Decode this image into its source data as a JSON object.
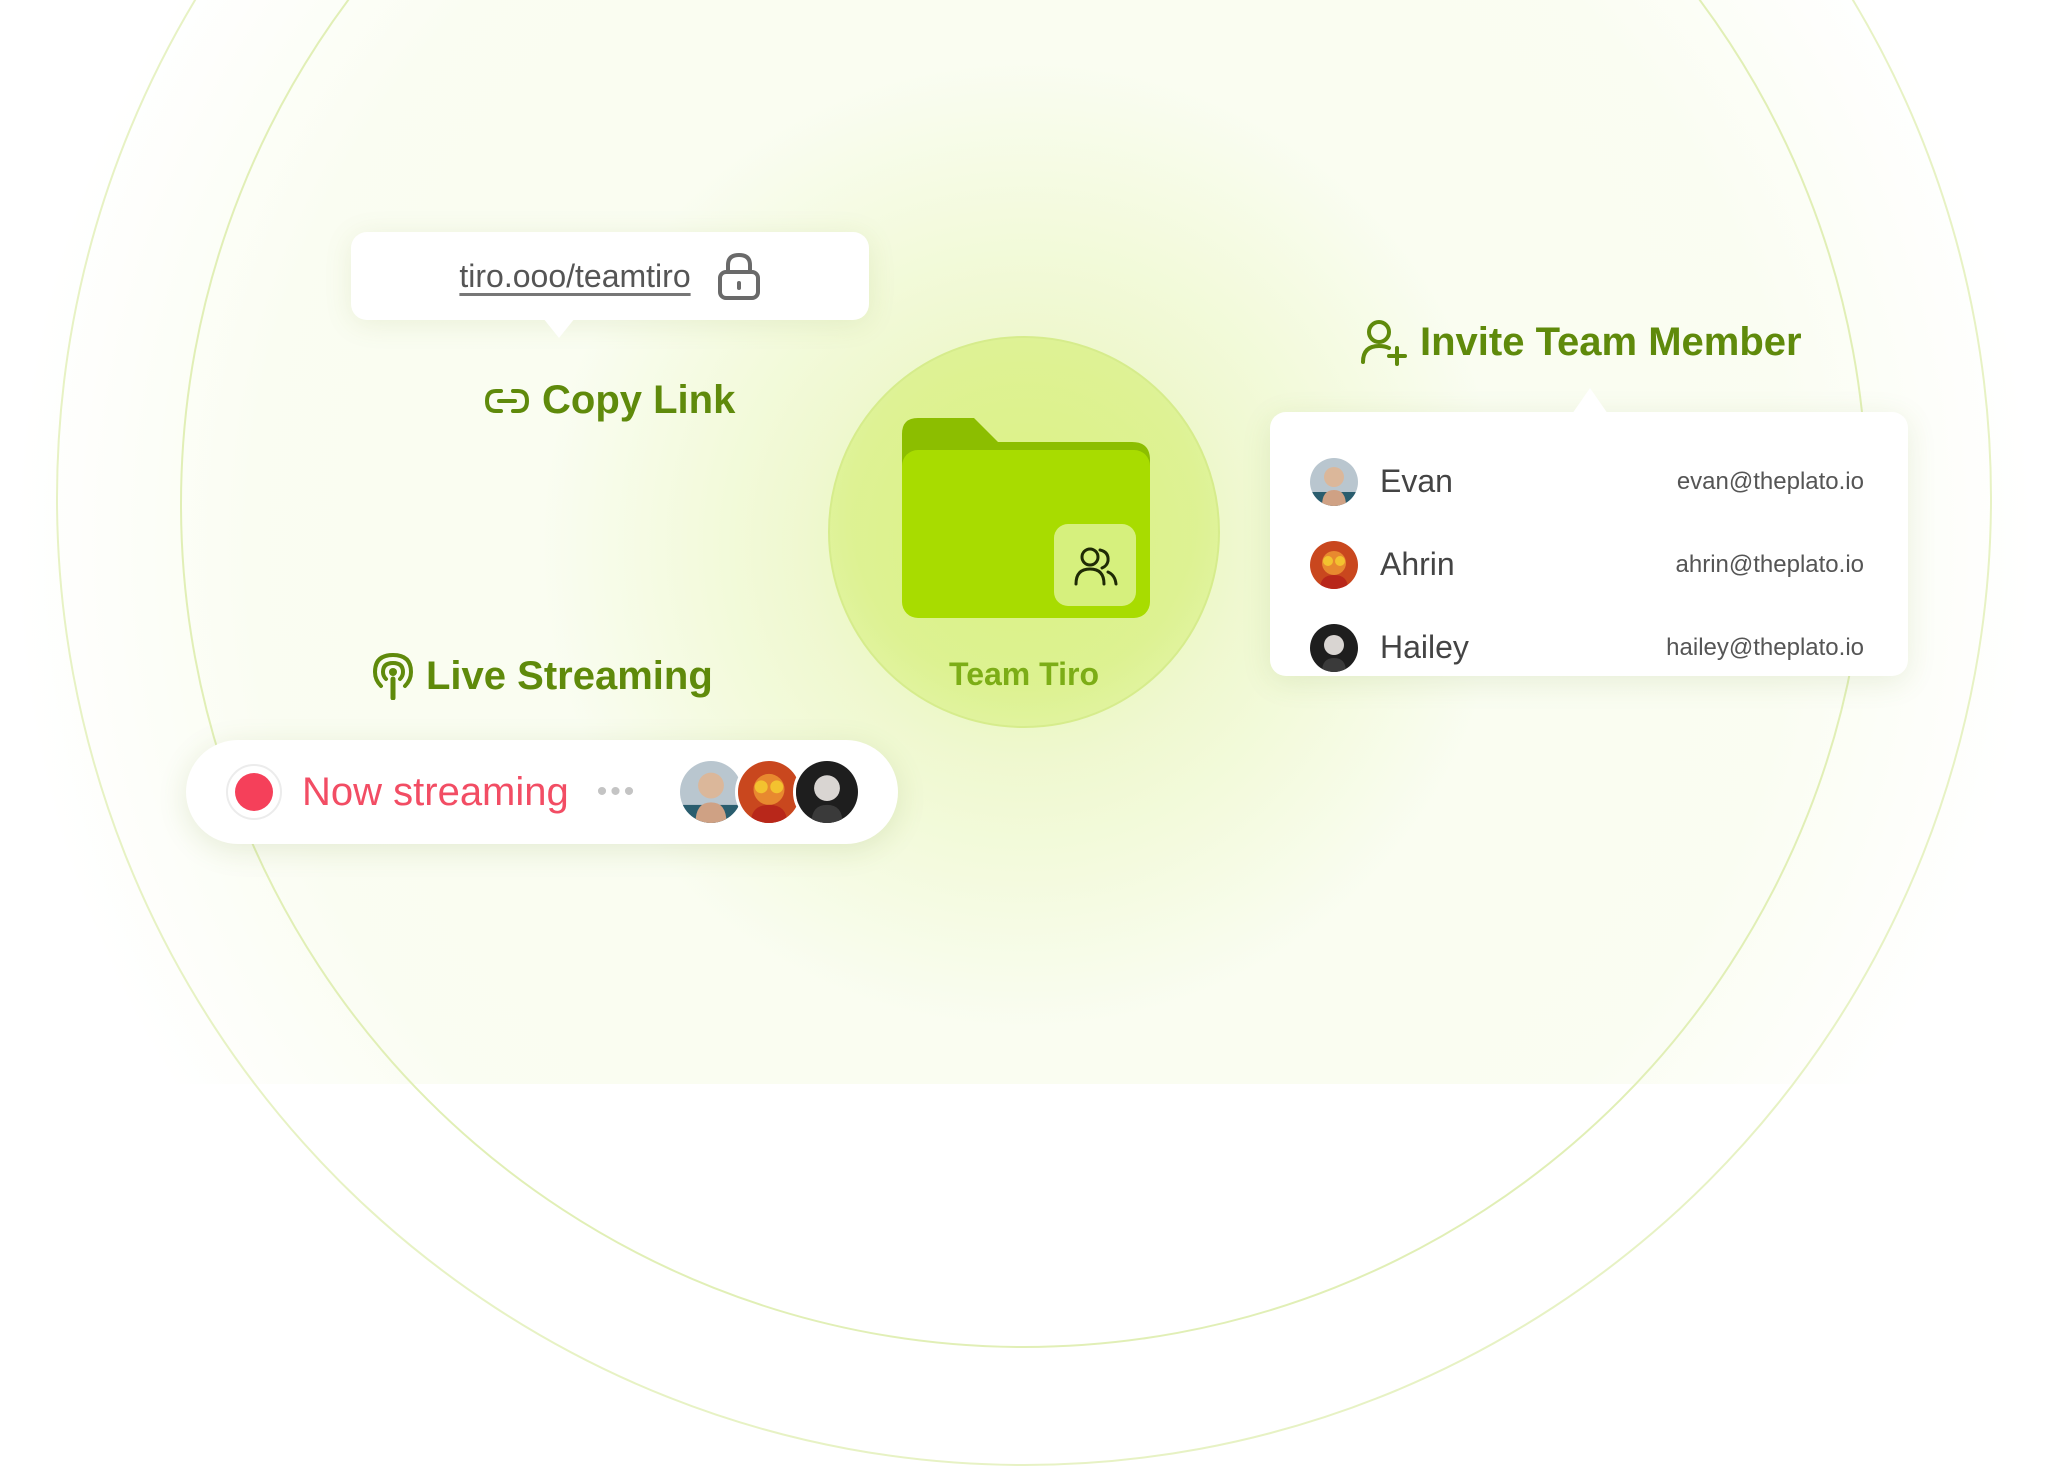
{
  "team": {
    "name": "Team Tiro",
    "folder_icon": "folder-icon",
    "badge_icon": "users-icon"
  },
  "copy_link": {
    "url": "tiro.ooo/teamtiro",
    "title": "Copy Link",
    "icon": "link-icon",
    "lock_icon": "lock-icon"
  },
  "invite": {
    "title": "Invite Team Member",
    "icon": "user-plus-icon",
    "members": [
      {
        "name": "Evan",
        "email": "evan@theplato.io"
      },
      {
        "name": "Ahrin",
        "email": "ahrin@theplato.io"
      },
      {
        "name": "Hailey",
        "email": "hailey@theplato.io"
      }
    ]
  },
  "live": {
    "title": "Live Streaming",
    "icon": "podcast-icon",
    "status": "Now streaming",
    "more": "•••"
  },
  "colors": {
    "accent": "#5f8a0b",
    "folder": "#a8dc00",
    "live": "#f24d64"
  }
}
